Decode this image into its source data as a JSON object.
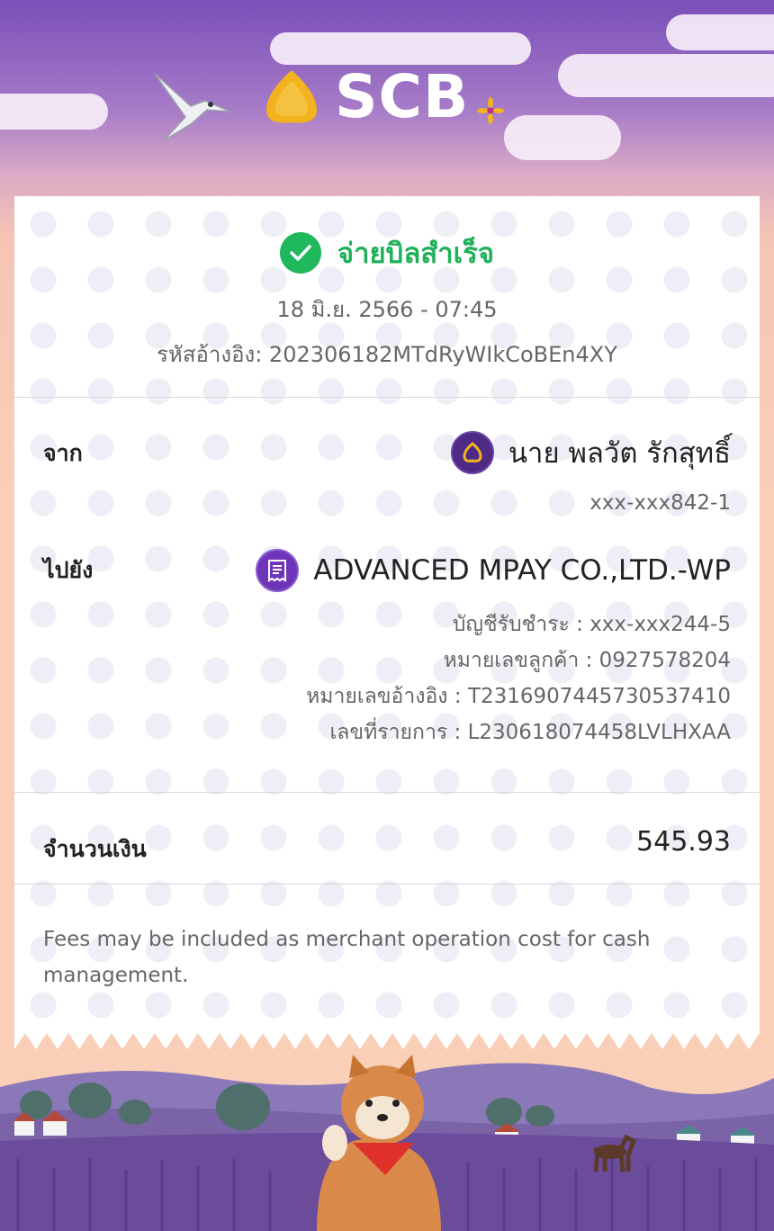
{
  "brand": {
    "name": "SCB"
  },
  "status": {
    "text": "จ่ายบิลสำเร็จ",
    "icon": "check-circle-icon",
    "color": "#1fb85c"
  },
  "transaction": {
    "datetime": "18 มิ.ย. 2566 - 07:45",
    "reference": "รหัสอ้างอิง: 202306182MTdRyWIkCoBEn4XY"
  },
  "from": {
    "label": "จาก",
    "name": "นาย พลวัต รักสุทธิ์",
    "account": "xxx-xxx842-1",
    "icon": "scb-logo-icon"
  },
  "to": {
    "label": "ไปยัง",
    "name": "ADVANCED MPAY CO.,LTD.-WP",
    "icon": "bill-receipt-icon",
    "details": [
      "บัญชีรับชำระ : xxx-xxx244-5",
      "หมายเลขลูกค้า : 0927578204",
      "หมายเลขอ้างอิง : T2316907445730537410",
      "เลขที่รายการ : L230618074458LVLHXAA"
    ]
  },
  "amount": {
    "label": "จำนวนเงิน",
    "value": "545.93"
  },
  "note": "Fees may be included as merchant operation cost for cash management.",
  "colors": {
    "brand_purple": "#4e2a84",
    "brand_gold": "#f0b323",
    "success": "#1fb85c"
  }
}
